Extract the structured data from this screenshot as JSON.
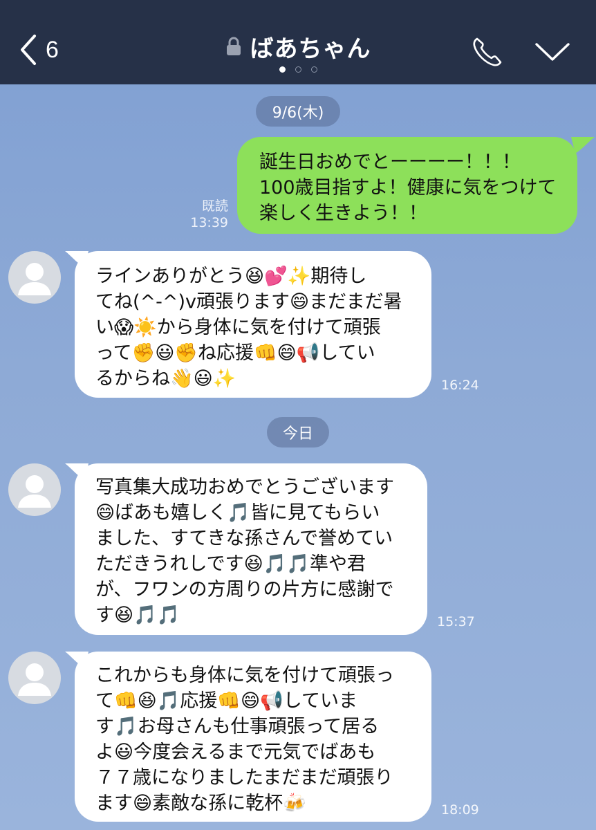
{
  "header": {
    "back_count": "6",
    "title": "ばあちゃん",
    "page_dots": 3,
    "active_dot": 0
  },
  "colors": {
    "header_bg": "#263148",
    "sent_bubble": "#8de05a",
    "received_bubble": "#ffffff",
    "chat_bg": "#8aa6d4"
  },
  "icons": {
    "back": "chevron-left-icon",
    "lock": "lock-icon",
    "call": "phone-icon",
    "menu": "chevron-down-icon",
    "avatar": "default-avatar-icon"
  },
  "dates": {
    "first": "9/6(木)",
    "second": "今日"
  },
  "messages": [
    {
      "side": "sent",
      "text": "誕生日おめでとーーーー！！！\n100歳目指すよ！健康に気をつけて\n楽しく生きよう！！",
      "read": "既読",
      "time": "13:39"
    },
    {
      "side": "received",
      "text": "ラインありがとう😆💕✨期待し\nてね(^-^)v頑張ります😄まだまだ暑\nい😱☀️から身体に気を付けて頑張\nって✊😃✊ね応援👊😄📢してい\nるからね👋😃✨",
      "time": "16:24"
    },
    {
      "side": "received",
      "text": "写真集大成功おめでとうございます\n😄ばあも嬉しく🎵皆に見てもらい\nました、すてきな孫さんで誉めてい\nただきうれしです😆🎵🎵準や君\nが、フワンの方周りの片方に感謝で\nす😆🎵🎵",
      "time": "15:37"
    },
    {
      "side": "received",
      "text": "これからも身体に気を付けて頑張っ\nて👊😆🎵応援👊😄📢していま\nす🎵お母さんも仕事頑張って居る\nよ😃今度会えるまで元気でばあも\n７７歳になりましたまだまだ頑張り\nます😄素敵な孫に乾杯🍻",
      "time": "18:09"
    }
  ]
}
